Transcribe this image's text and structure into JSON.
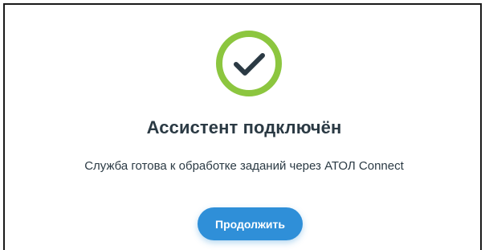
{
  "dialog": {
    "icon": "check-circle-icon",
    "title": "Ассистент подключён",
    "message": "Служба готова к обработке заданий через АТОЛ Connect",
    "continue_label": "Продолжить"
  },
  "colors": {
    "success_ring": "#8cc63f",
    "check_mark": "#2b3a44",
    "primary_button": "#2f8fd8",
    "text": "#2b3a44"
  }
}
